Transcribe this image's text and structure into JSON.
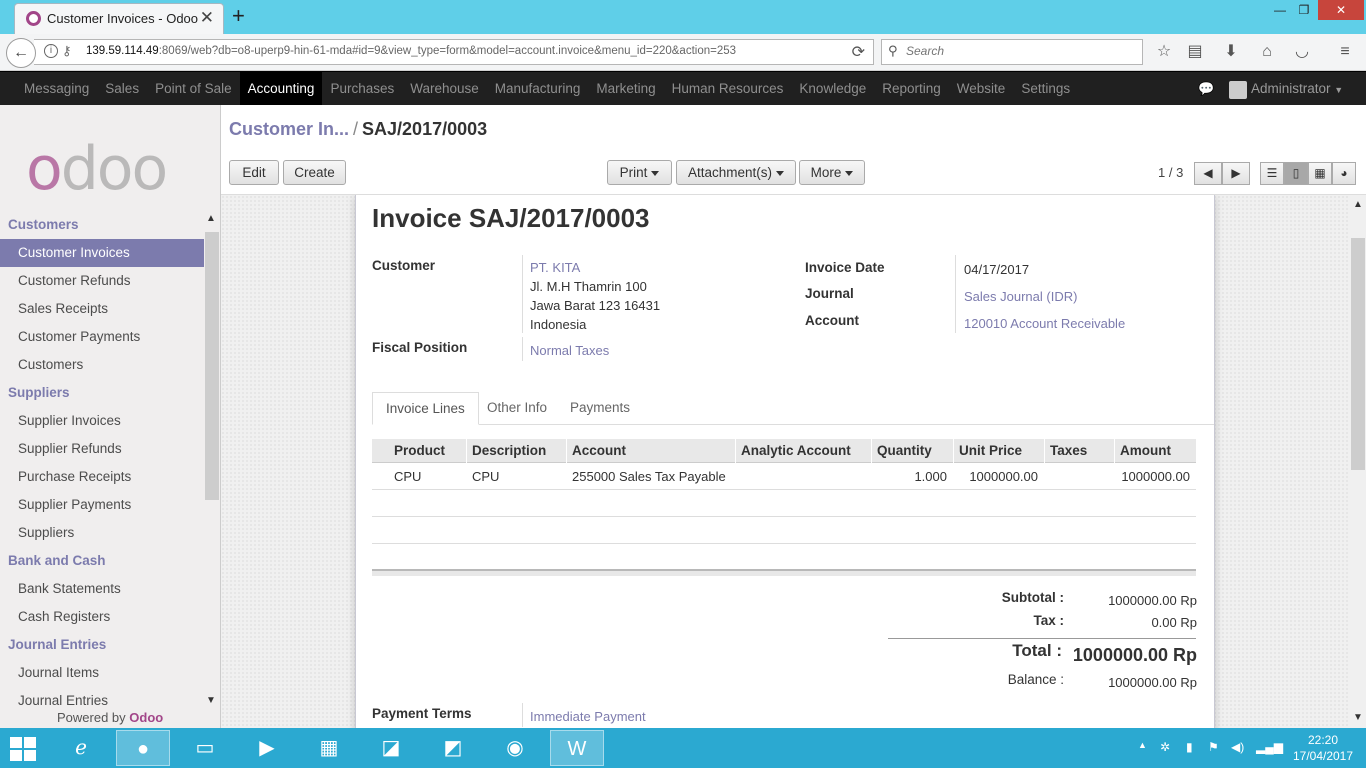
{
  "browser": {
    "tab_title": "Customer Invoices - Odoo",
    "url_host": "139.59.114.49",
    "url_rest": ":8069/web?db=o8-uperp9-hin-61-mda#id=9&view_type=form&model=account.invoice&menu_id=220&action=253",
    "search_placeholder": "Search"
  },
  "topmenu": {
    "items": [
      "Messaging",
      "Sales",
      "Point of Sale",
      "Accounting",
      "Purchases",
      "Warehouse",
      "Manufacturing",
      "Marketing",
      "Human Resources",
      "Knowledge",
      "Reporting",
      "Website",
      "Settings"
    ],
    "active": "Accounting",
    "user": "Administrator"
  },
  "sidebar": {
    "sections": [
      {
        "title": "Customers",
        "items": [
          "Customer Invoices",
          "Customer Refunds",
          "Sales Receipts",
          "Customer Payments",
          "Customers"
        ]
      },
      {
        "title": "Suppliers",
        "items": [
          "Supplier Invoices",
          "Supplier Refunds",
          "Purchase Receipts",
          "Supplier Payments",
          "Suppliers"
        ]
      },
      {
        "title": "Bank and Cash",
        "items": [
          "Bank Statements",
          "Cash Registers"
        ]
      },
      {
        "title": "Journal Entries",
        "items": [
          "Journal Items",
          "Journal Entries"
        ]
      }
    ],
    "active_item": "Customer Invoices",
    "powered_by": "Powered by",
    "powered_brand": "Odoo",
    "logo_o": "o",
    "logo_rest": "doo"
  },
  "control": {
    "breadcrumb_parent": "Customer In...",
    "breadcrumb_sep": "/",
    "breadcrumb_current": "SAJ/2017/0003",
    "edit": "Edit",
    "create": "Create",
    "print": "Print",
    "attachments": "Attachment(s)",
    "more": "More",
    "pager": "1 / 3"
  },
  "invoice": {
    "title": "Invoice SAJ/2017/0003",
    "customer_label": "Customer",
    "customer_name": "PT. KITA",
    "address_line1": "Jl. M.H Thamrin 100",
    "address_line2": "Jawa Barat 123 16431",
    "address_line3": "Indonesia",
    "fiscal_position_label": "Fiscal Position",
    "fiscal_position": "Normal Taxes",
    "invoice_date_label": "Invoice Date",
    "invoice_date": "04/17/2017",
    "journal_label": "Journal",
    "journal": "Sales Journal (IDR)",
    "account_label": "Account",
    "account": "120010 Account Receivable",
    "tabs": [
      "Invoice Lines",
      "Other Info",
      "Payments"
    ],
    "columns": [
      "Product",
      "Description",
      "Account",
      "Analytic Account",
      "Quantity",
      "Unit Price",
      "Taxes",
      "Amount"
    ],
    "lines": [
      {
        "product": "CPU",
        "description": "CPU",
        "account": "255000 Sales Tax Payable",
        "analytic": "",
        "quantity": "1.000",
        "unit_price": "1000000.00",
        "taxes": "",
        "amount": "1000000.00"
      }
    ],
    "subtotal_label": "Subtotal :",
    "subtotal": "1000000.00 Rp",
    "tax_label": "Tax :",
    "tax": "0.00 Rp",
    "total_label": "Total :",
    "total": "1000000.00 Rp",
    "balance_label": "Balance :",
    "balance": "1000000.00 Rp",
    "payment_terms_label": "Payment Terms",
    "payment_terms": "Immediate Payment"
  },
  "taskbar": {
    "time": "22:20",
    "date": "17/04/2017"
  },
  "colors": {
    "odoo_purple": "#7c7bad",
    "odoo_brand": "#a24689",
    "browser_accent": "#5fcfe8",
    "taskbar": "#2ba9d1"
  }
}
